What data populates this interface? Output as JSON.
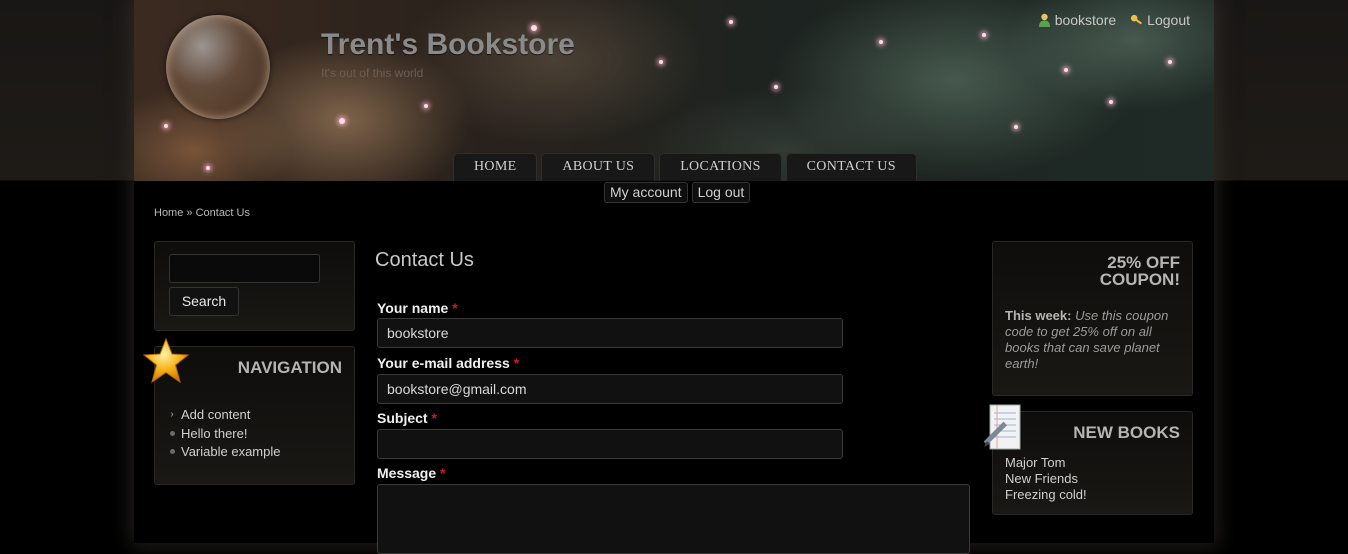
{
  "header": {
    "site_name": "Trent's Bookstore",
    "slogan": "It's out of this world",
    "user_links": [
      {
        "label": "bookstore",
        "icon": "user-icon"
      },
      {
        "label": "Logout",
        "icon": "key-icon"
      }
    ]
  },
  "primary_nav": [
    "HOME",
    "ABOUT US",
    "LOCATIONS",
    "CONTACT US"
  ],
  "secondary_nav": [
    "My account",
    "Log out"
  ],
  "breadcrumb": {
    "home": "Home",
    "separator": " » ",
    "current": "Contact Us"
  },
  "search_block": {
    "button_label": "Search",
    "input_value": ""
  },
  "navigation_block": {
    "title": "NAVIGATION",
    "items": [
      {
        "label": "Add content",
        "marker": "chevron"
      },
      {
        "label": "Hello there!",
        "marker": "bullet"
      },
      {
        "label": "Variable example",
        "marker": "bullet"
      }
    ]
  },
  "contact_form": {
    "title": "Contact Us",
    "required_marker": "*",
    "fields": {
      "name": {
        "label": "Your name",
        "value": "bookstore"
      },
      "email": {
        "label": "Your e-mail address",
        "value": "bookstore@gmail.com"
      },
      "subject": {
        "label": "Subject",
        "value": ""
      },
      "message": {
        "label": "Message",
        "value": ""
      }
    }
  },
  "coupon_block": {
    "title_line1": "25% OFF",
    "title_line2": "COUPON!",
    "lead": "This week:",
    "text": "Use this coupon code to get 25% off on all books that can save planet earth!"
  },
  "new_books_block": {
    "title": "NEW BOOKS",
    "items": [
      "Major Tom",
      "New Friends",
      "Freezing cold!"
    ]
  },
  "colors": {
    "background": "#000000",
    "text": "#cfcfcf",
    "required": "#cc1d1d",
    "block_border": "#2a2825"
  }
}
